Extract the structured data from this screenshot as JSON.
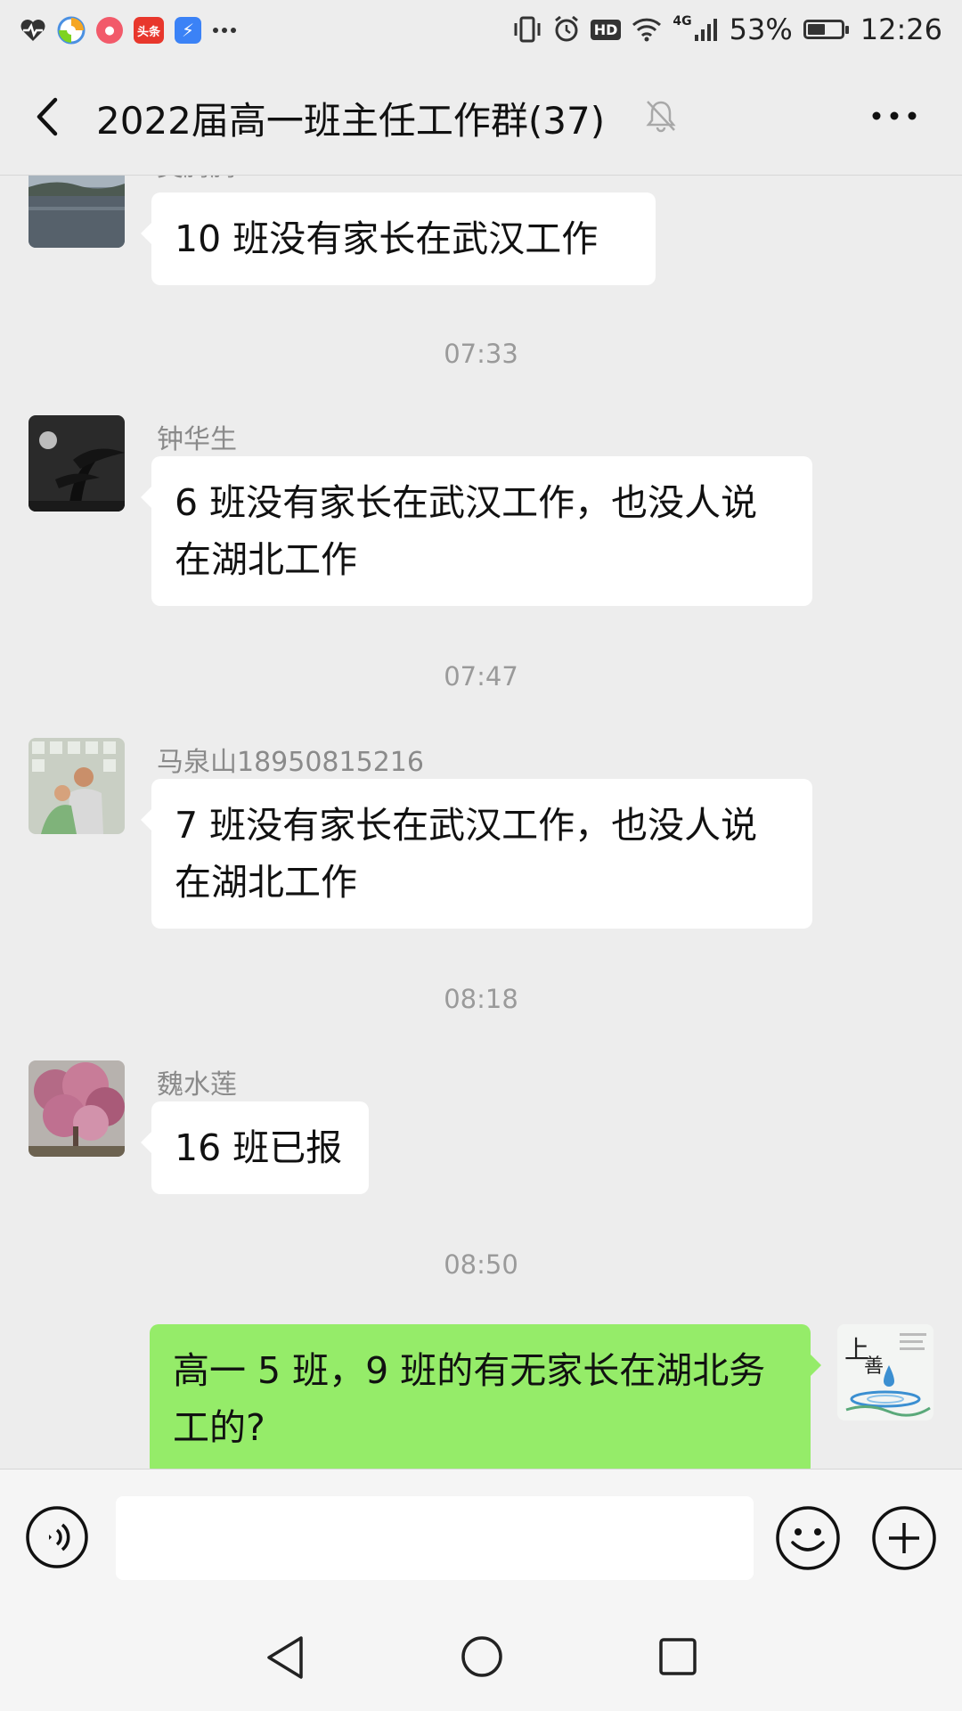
{
  "status_bar": {
    "left_icons": [
      "health-heart-icon",
      "browser-icon",
      "video-app-icon",
      "news-app-icon",
      "lightning-app-icon",
      "more-dots-icon"
    ],
    "news_app_label": "头条",
    "network": "4G",
    "hd_label": "HD",
    "battery": "53%",
    "battery_fraction": 0.53,
    "time": "12:26"
  },
  "header": {
    "title": "2022届高一班主任工作群(37)",
    "muted": true
  },
  "messages": [
    {
      "type": "incoming",
      "sender": "吴腾腾",
      "text": "10 班没有家长在武汉工作",
      "avatar": "lake-landscape"
    },
    {
      "type": "time",
      "text": "07:33"
    },
    {
      "type": "incoming",
      "sender": "钟华生",
      "text": "6 班没有家长在武汉工作，也没人说在湖北工作",
      "avatar": "moon-pine-silhouette"
    },
    {
      "type": "time",
      "text": "07:47"
    },
    {
      "type": "incoming",
      "sender": "马泉山18950815216",
      "text": "7 班没有家长在武汉工作，也没人说在湖北工作",
      "avatar": "children-photo"
    },
    {
      "type": "time",
      "text": "08:18"
    },
    {
      "type": "incoming",
      "sender": "魏水莲",
      "text": "16 班已报",
      "avatar": "magnolia-tree"
    },
    {
      "type": "time",
      "text": "08:50"
    },
    {
      "type": "outgoing",
      "text": "高一 5 班，9 班的有无家长在湖北务工的?",
      "avatar": "water-drop-calligraphy"
    }
  ],
  "input_bar": {
    "placeholder": "",
    "voice_icon": "voice-icon",
    "emoji_icon": "emoji-icon",
    "plus_icon": "plus-icon"
  },
  "nav_bar": {
    "icons": [
      "nav-back-icon",
      "nav-home-icon",
      "nav-recent-icon"
    ]
  }
}
